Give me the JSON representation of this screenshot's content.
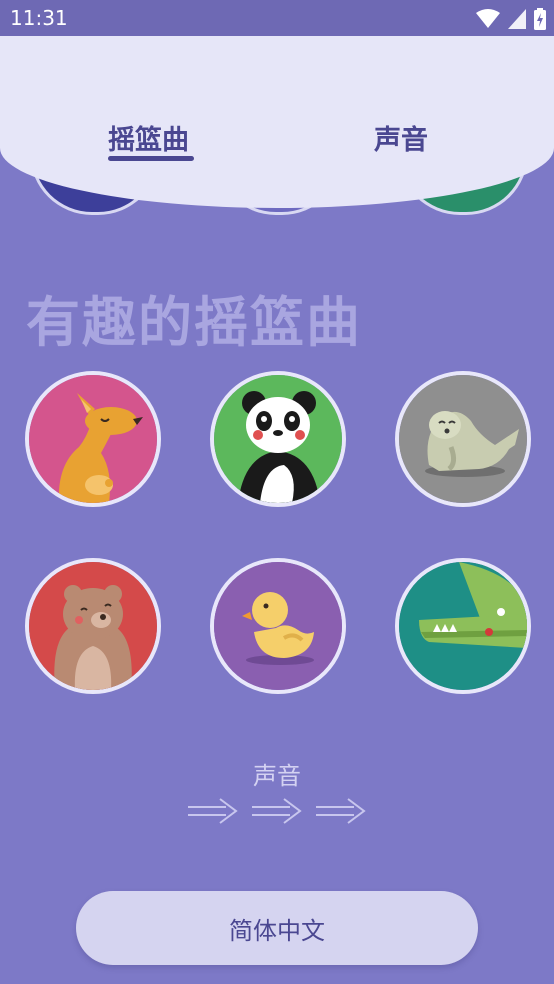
{
  "status_bar": {
    "time": "11:31"
  },
  "tabs": [
    {
      "label": "摇篮曲",
      "active": true
    },
    {
      "label": "声音",
      "active": false
    }
  ],
  "section": {
    "title": "有趣的摇篮曲"
  },
  "animals": [
    {
      "icon": "kangaroo-icon",
      "color": "#d4558d"
    },
    {
      "icon": "panda-icon",
      "color": "#5cb85c"
    },
    {
      "icon": "seal-icon",
      "color": "#8f8f8f"
    },
    {
      "icon": "bear-icon",
      "color": "#d44a4a"
    },
    {
      "icon": "duck-icon",
      "color": "#8a5fb0"
    },
    {
      "icon": "crocodile-icon",
      "color": "#1e8f86"
    }
  ],
  "sound_link": {
    "label": "声音"
  },
  "language_button": {
    "label": "简体中文"
  },
  "colors": {
    "background": "#7d79c7",
    "accent": "#4a4791",
    "card": "#e6e6f8"
  }
}
